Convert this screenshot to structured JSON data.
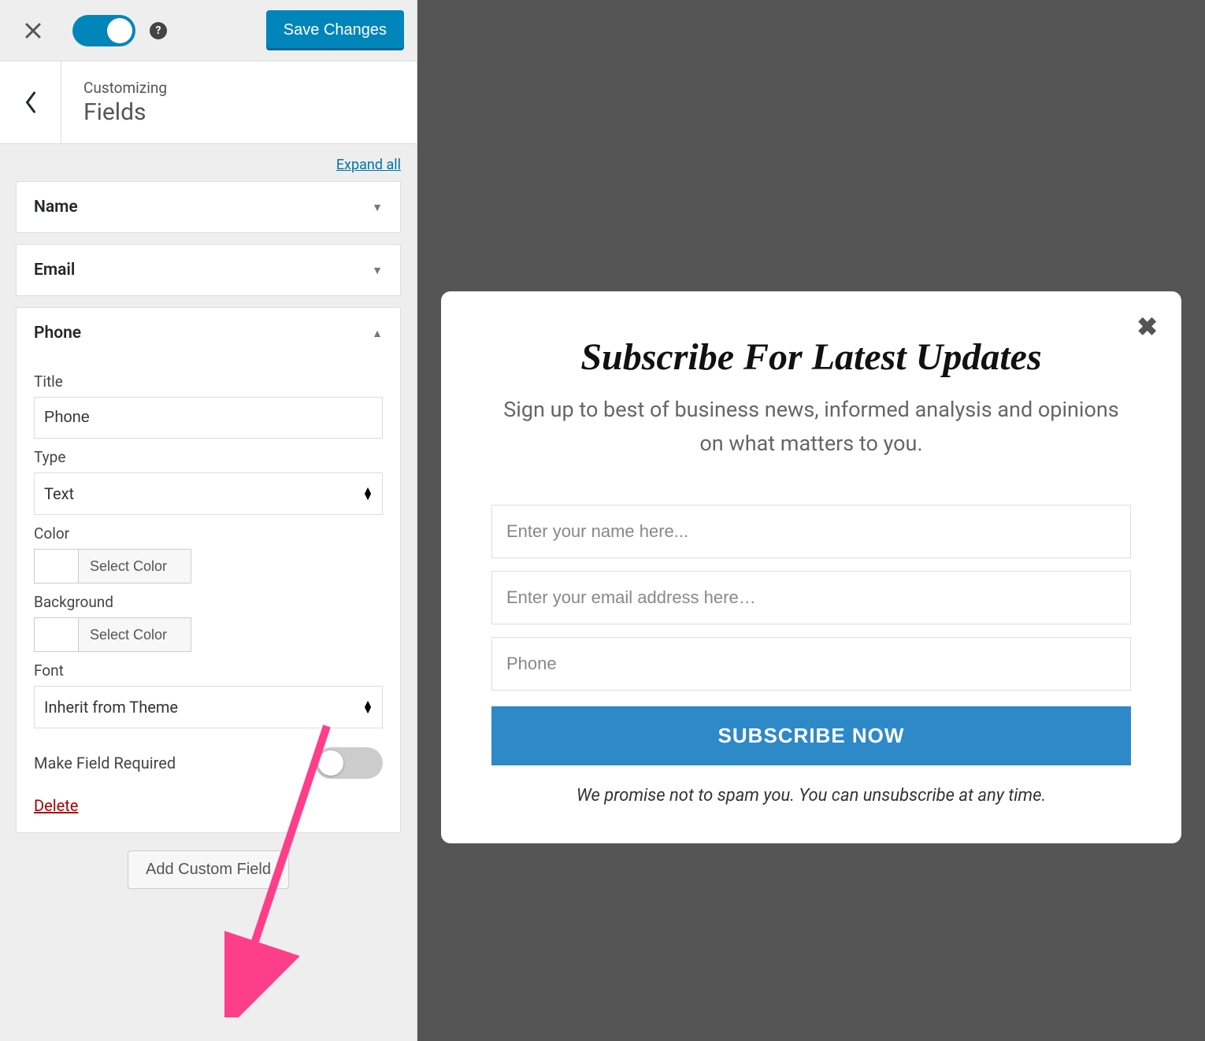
{
  "topbar": {
    "save_label": "Save Changes",
    "help_symbol": "?"
  },
  "breadcrumb": {
    "pretitle": "Customizing",
    "title": "Fields"
  },
  "panel": {
    "expand_all": "Expand all",
    "accordions": {
      "name_label": "Name",
      "email_label": "Email",
      "phone_label": "Phone"
    },
    "phone_fields": {
      "title_label": "Title",
      "title_value": "Phone",
      "type_label": "Type",
      "type_value": "Text",
      "color_label": "Color",
      "select_color_btn": "Select Color",
      "background_label": "Background",
      "font_label": "Font",
      "font_value": "Inherit from Theme",
      "required_label": "Make Field Required",
      "delete_label": "Delete"
    },
    "add_field_btn": "Add Custom Field"
  },
  "preview": {
    "heading": "Subscribe For Latest Updates",
    "subtext": "Sign up to best of business news, informed analysis and opinions on what matters to you.",
    "name_placeholder": "Enter your name here...",
    "email_placeholder": "Enter your email address here…",
    "phone_placeholder": "Phone",
    "submit_label": "SUBSCRIBE NOW",
    "promise": "We promise not to spam you. You can unsubscribe at any time.",
    "close_glyph": "✖"
  }
}
